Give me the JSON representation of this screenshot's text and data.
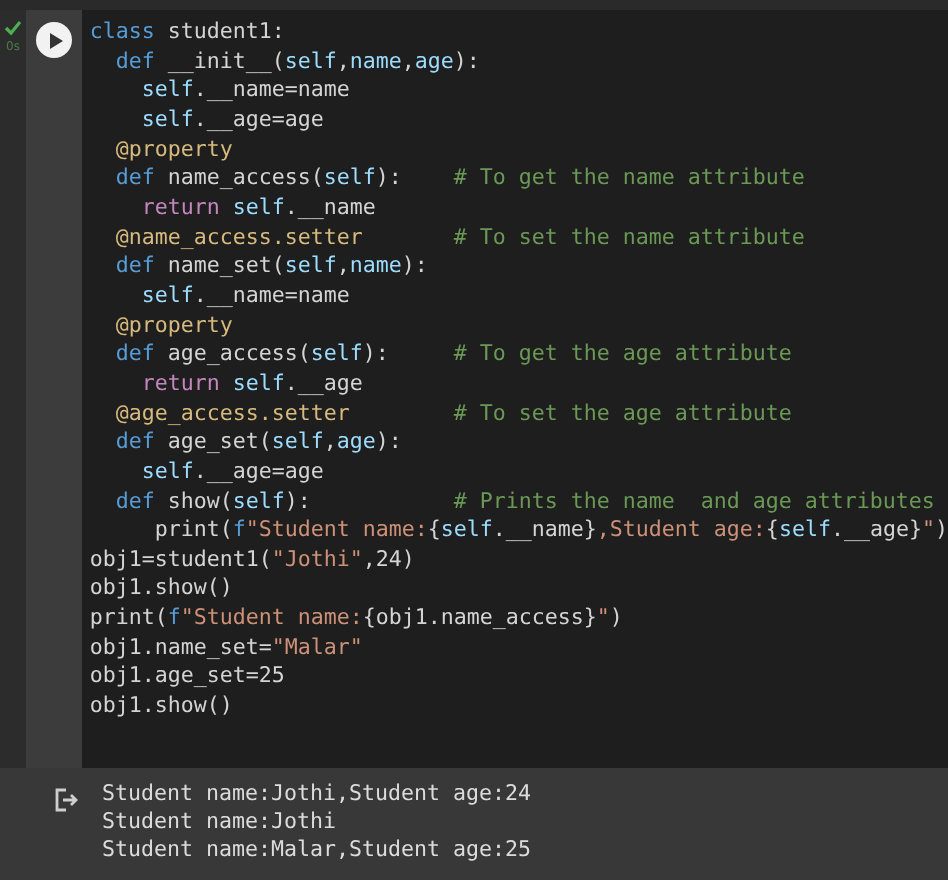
{
  "cell": {
    "status": {
      "done": true,
      "run_time": "0s"
    },
    "code_lines": [
      [
        {
          "kind": "kw",
          "text": "class"
        },
        {
          "kind": "plain",
          "text": " student1:"
        }
      ],
      [
        {
          "kind": "kw",
          "text": "  def"
        },
        {
          "kind": "plain",
          "text": " __init__("
        },
        {
          "kind": "var",
          "text": "self"
        },
        {
          "kind": "plain",
          "text": ","
        },
        {
          "kind": "var",
          "text": "name"
        },
        {
          "kind": "plain",
          "text": ","
        },
        {
          "kind": "var",
          "text": "age"
        },
        {
          "kind": "plain",
          "text": "):"
        }
      ],
      [
        {
          "kind": "var",
          "text": "    self"
        },
        {
          "kind": "plain",
          "text": ".__name=name"
        }
      ],
      [
        {
          "kind": "var",
          "text": "    self"
        },
        {
          "kind": "plain",
          "text": ".__age=age"
        }
      ],
      [
        {
          "kind": "dec",
          "text": "  @property"
        }
      ],
      [
        {
          "kind": "kw",
          "text": "  def"
        },
        {
          "kind": "plain",
          "text": " name_access("
        },
        {
          "kind": "var",
          "text": "self"
        },
        {
          "kind": "plain",
          "text": "):    "
        },
        {
          "kind": "cmt",
          "text": "# To get the name attribute"
        }
      ],
      [
        {
          "kind": "ctrl",
          "text": "    return "
        },
        {
          "kind": "var",
          "text": "self"
        },
        {
          "kind": "plain",
          "text": ".__name"
        }
      ],
      [
        {
          "kind": "dec",
          "text": "  @name_access.setter"
        },
        {
          "kind": "cmt",
          "text": "       # To set the name attribute"
        }
      ],
      [
        {
          "kind": "kw",
          "text": "  def"
        },
        {
          "kind": "plain",
          "text": " name_set("
        },
        {
          "kind": "var",
          "text": "self"
        },
        {
          "kind": "plain",
          "text": ","
        },
        {
          "kind": "var",
          "text": "name"
        },
        {
          "kind": "plain",
          "text": "):"
        }
      ],
      [
        {
          "kind": "var",
          "text": "    self"
        },
        {
          "kind": "plain",
          "text": ".__name=name"
        }
      ],
      [
        {
          "kind": "dec",
          "text": "  @property"
        }
      ],
      [
        {
          "kind": "kw",
          "text": "  def"
        },
        {
          "kind": "plain",
          "text": " age_access("
        },
        {
          "kind": "var",
          "text": "self"
        },
        {
          "kind": "plain",
          "text": "):     "
        },
        {
          "kind": "cmt",
          "text": "# To get the age attribute"
        }
      ],
      [
        {
          "kind": "ctrl",
          "text": "    return "
        },
        {
          "kind": "var",
          "text": "self"
        },
        {
          "kind": "plain",
          "text": ".__age"
        }
      ],
      [
        {
          "kind": "dec",
          "text": "  @age_access.setter"
        },
        {
          "kind": "cmt",
          "text": "        # To set the age attribute"
        }
      ],
      [
        {
          "kind": "kw",
          "text": "  def"
        },
        {
          "kind": "plain",
          "text": " age_set("
        },
        {
          "kind": "var",
          "text": "self"
        },
        {
          "kind": "plain",
          "text": ","
        },
        {
          "kind": "var",
          "text": "age"
        },
        {
          "kind": "plain",
          "text": "):"
        }
      ],
      [
        {
          "kind": "var",
          "text": "    self"
        },
        {
          "kind": "plain",
          "text": ".__age=age"
        }
      ],
      [
        {
          "kind": "kw",
          "text": "  def"
        },
        {
          "kind": "plain",
          "text": " show("
        },
        {
          "kind": "var",
          "text": "self"
        },
        {
          "kind": "plain",
          "text": "):           "
        },
        {
          "kind": "cmt",
          "text": "# Prints the name  and age attributes"
        }
      ],
      [
        {
          "kind": "plain",
          "text": "     print("
        },
        {
          "kind": "kw",
          "text": "f"
        },
        {
          "kind": "str",
          "text": "\"Student name:"
        },
        {
          "kind": "plain",
          "text": "{"
        },
        {
          "kind": "var",
          "text": "self"
        },
        {
          "kind": "plain",
          "text": ".__name}"
        },
        {
          "kind": "str",
          "text": ",Student age:"
        },
        {
          "kind": "plain",
          "text": "{"
        },
        {
          "kind": "var",
          "text": "self"
        },
        {
          "kind": "plain",
          "text": ".__age}"
        },
        {
          "kind": "str",
          "text": "\""
        },
        {
          "kind": "plain",
          "text": ")"
        }
      ],
      [
        {
          "kind": "plain",
          "text": "obj1=student1("
        },
        {
          "kind": "str",
          "text": "\"Jothi\""
        },
        {
          "kind": "plain",
          "text": ",24)"
        }
      ],
      [
        {
          "kind": "plain",
          "text": "obj1.show()"
        }
      ],
      [
        {
          "kind": "plain",
          "text": "print("
        },
        {
          "kind": "kw",
          "text": "f"
        },
        {
          "kind": "str",
          "text": "\"Student name:"
        },
        {
          "kind": "plain",
          "text": "{obj1.name_access}"
        },
        {
          "kind": "str",
          "text": "\""
        },
        {
          "kind": "plain",
          "text": ")"
        }
      ],
      [
        {
          "kind": "plain",
          "text": "obj1.name_set="
        },
        {
          "kind": "str",
          "text": "\"Malar\""
        }
      ],
      [
        {
          "kind": "plain",
          "text": "obj1.age_set=25"
        }
      ],
      [
        {
          "kind": "plain",
          "text": "obj1.show()"
        }
      ]
    ],
    "output_lines": [
      "Student name:Jothi,Student age:24",
      "Student name:Jothi",
      "Student name:Malar,Student age:25"
    ]
  }
}
